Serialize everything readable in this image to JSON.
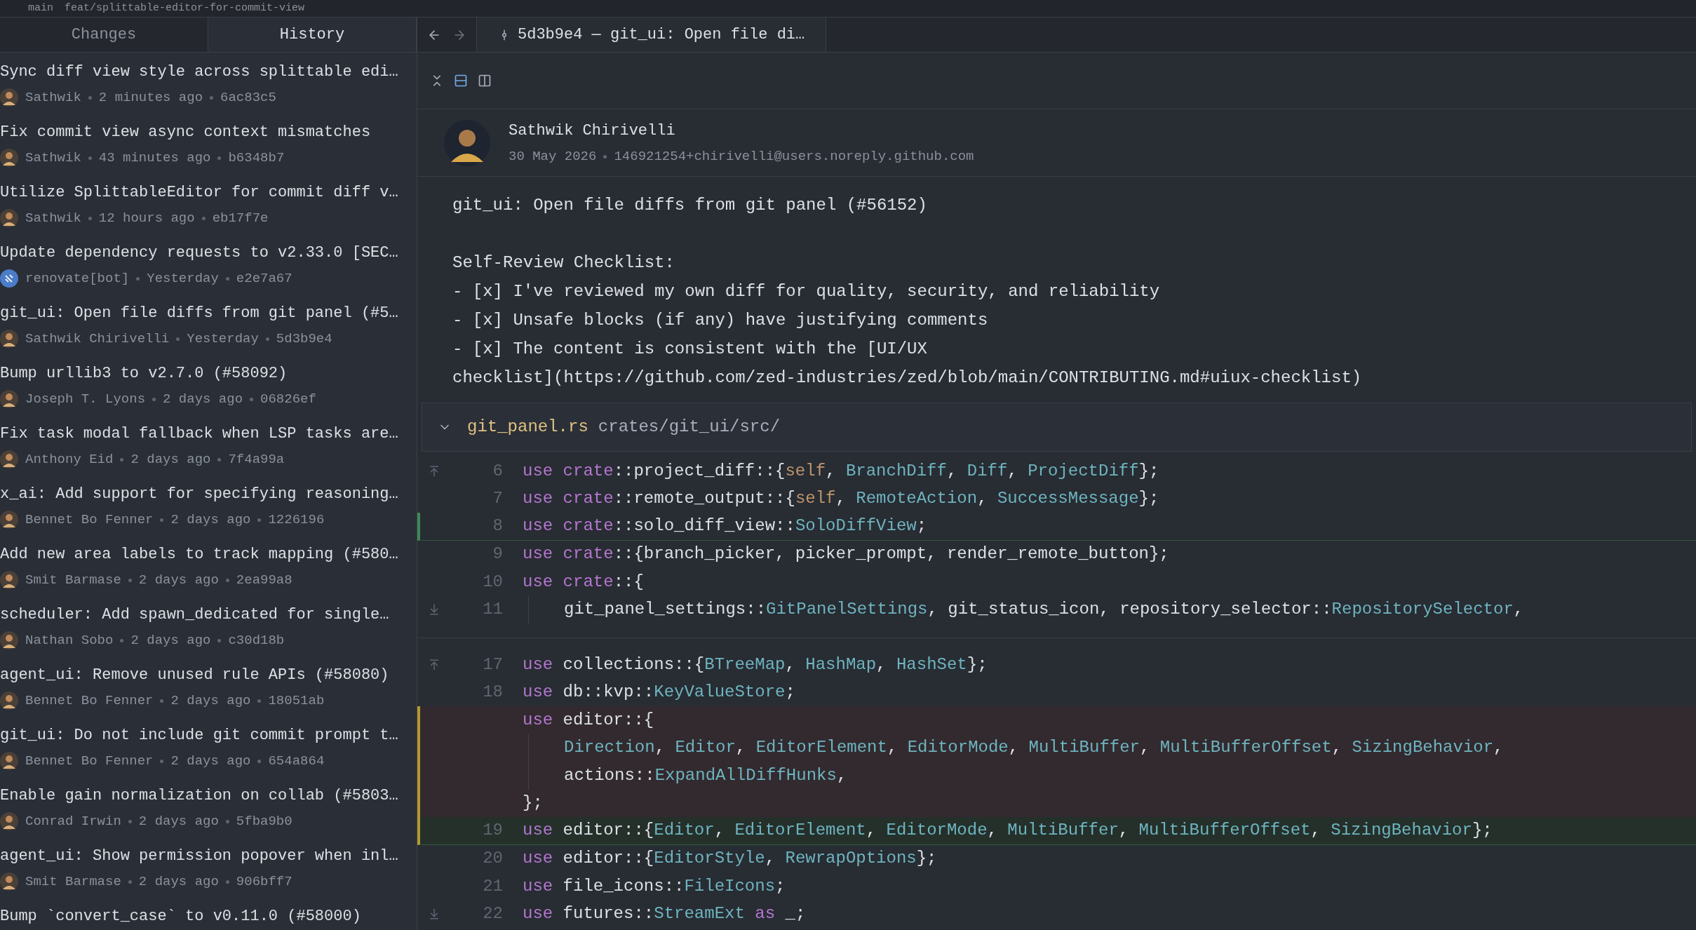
{
  "breadcrumb": [
    "main",
    "feat/splittable-editor-for-commit-view"
  ],
  "panel_tabs": [
    {
      "label": "Changes",
      "selected": false
    },
    {
      "label": "History",
      "selected": true
    }
  ],
  "commits": [
    {
      "title": "Sync diff view style across splittable edi…",
      "author": "Sathwik",
      "time": "2 minutes ago",
      "sha": "6ac83c5",
      "kind": "person"
    },
    {
      "title": "Fix commit view async context mismatches",
      "author": "Sathwik",
      "time": "43 minutes ago",
      "sha": "b6348b7",
      "kind": "person"
    },
    {
      "title": "Utilize SplittableEditor for commit diff v…",
      "author": "Sathwik",
      "time": "12 hours ago",
      "sha": "eb17f7e",
      "kind": "person"
    },
    {
      "title": "Update dependency requests to v2.33.0 [SEC…",
      "author": "renovate[bot]",
      "time": "Yesterday",
      "sha": "e2e7a67",
      "kind": "bot"
    },
    {
      "title": "git_ui: Open file diffs from git panel (#5…",
      "author": "Sathwik Chirivelli",
      "time": "Yesterday",
      "sha": "5d3b9e4",
      "kind": "person"
    },
    {
      "title": "Bump urllib3 to v2.7.0 (#58092)",
      "author": "Joseph T. Lyons",
      "time": "2 days ago",
      "sha": "06826ef",
      "kind": "person"
    },
    {
      "title": "Fix task modal fallback when LSP tasks are…",
      "author": "Anthony Eid",
      "time": "2 days ago",
      "sha": "7f4a99a",
      "kind": "person"
    },
    {
      "title": "x_ai: Add support for specifying reasoning…",
      "author": "Bennet Bo Fenner",
      "time": "2 days ago",
      "sha": "1226196",
      "kind": "person"
    },
    {
      "title": "Add new area labels to track mapping (#580…",
      "author": "Smit Barmase",
      "time": "2 days ago",
      "sha": "2ea99a8",
      "kind": "person"
    },
    {
      "title": "scheduler: Add spawn_dedicated for single…",
      "author": "Nathan Sobo",
      "time": "2 days ago",
      "sha": "c30d18b",
      "kind": "person"
    },
    {
      "title": "agent_ui: Remove unused rule APIs (#58080)",
      "author": "Bennet Bo Fenner",
      "time": "2 days ago",
      "sha": "18051ab",
      "kind": "person"
    },
    {
      "title": "git_ui: Do not include git commit prompt t…",
      "author": "Bennet Bo Fenner",
      "time": "2 days ago",
      "sha": "654a864",
      "kind": "person"
    },
    {
      "title": "Enable gain normalization on collab (#5803…",
      "author": "Conrad Irwin",
      "time": "2 days ago",
      "sha": "5fba9b0",
      "kind": "person"
    },
    {
      "title": "agent_ui: Show permission popover when inl…",
      "author": "Smit Barmase",
      "time": "2 days ago",
      "sha": "906bff7",
      "kind": "person"
    },
    {
      "title": "Bump `convert_case` to v0.11.0 (#58000)"
    }
  ],
  "editor_tab": {
    "label": "5d3b9e4 — git_ui: Open file di…",
    "selected": true
  },
  "view_modes": [
    {
      "kind": "unified",
      "selected": true
    },
    {
      "kind": "split",
      "selected": false
    }
  ],
  "commit": {
    "author": "Sathwik Chirivelli",
    "date": "30 May 2026",
    "email": "146921254+chirivelli@users.noreply.github.com",
    "message": [
      [
        "git_ui: Open file diffs from git panel (#56152)"
      ],
      [
        "Self-Review Checklist:",
        "- [x] I've reviewed my own diff for quality, security, and reliability",
        "- [x] Unsafe blocks (if any) have justifying comments",
        "- [x] The content is consistent with the [UI/UX",
        "checklist](https://github.com/zed-industries/zed/blob/main/CONTRIBUTING.md#uiux-checklist)"
      ]
    ]
  },
  "file": {
    "name": "git_panel.rs",
    "path": "crates/git_ui/src/",
    "expanded": true
  },
  "hunks": [
    [
      {
        "number": "6",
        "kind": "context",
        "indent": false,
        "expand_up": true,
        "expand_down": false,
        "tokens": [
          {
            "text": "use ",
            "kind": "keyword"
          },
          {
            "text": "crate",
            "kind": "keyword"
          },
          {
            "text": "::project_diff::{",
            "kind": "plain"
          },
          {
            "text": "self",
            "kind": "self"
          },
          {
            "text": ", ",
            "kind": "plain"
          },
          {
            "text": "BranchDiff",
            "kind": "type"
          },
          {
            "text": ", ",
            "kind": "plain"
          },
          {
            "text": "Diff",
            "kind": "type"
          },
          {
            "text": ", ",
            "kind": "plain"
          },
          {
            "text": "ProjectDiff",
            "kind": "type"
          },
          {
            "text": "};",
            "kind": "plain"
          }
        ]
      },
      {
        "number": "7",
        "kind": "context",
        "indent": false,
        "expand_up": false,
        "expand_down": false,
        "tokens": [
          {
            "text": "use ",
            "kind": "keyword"
          },
          {
            "text": "crate",
            "kind": "keyword"
          },
          {
            "text": "::remote_output::{",
            "kind": "plain"
          },
          {
            "text": "self",
            "kind": "self"
          },
          {
            "text": ", ",
            "kind": "plain"
          },
          {
            "text": "RemoteAction",
            "kind": "type"
          },
          {
            "text": ", ",
            "kind": "plain"
          },
          {
            "text": "SuccessMessage",
            "kind": "type"
          },
          {
            "text": "};",
            "kind": "plain"
          }
        ]
      },
      {
        "number": "8",
        "kind": "added",
        "indent": false,
        "expand_up": false,
        "expand_down": false,
        "tokens": [
          {
            "text": "use ",
            "kind": "keyword"
          },
          {
            "text": "crate",
            "kind": "keyword"
          },
          {
            "text": "::solo_diff_view::",
            "kind": "plain"
          },
          {
            "text": "SoloDiffView",
            "kind": "type"
          },
          {
            "text": ";",
            "kind": "plain"
          }
        ]
      },
      {
        "number": "9",
        "kind": "context",
        "indent": false,
        "expand_up": false,
        "expand_down": false,
        "tokens": [
          {
            "text": "use ",
            "kind": "keyword"
          },
          {
            "text": "crate",
            "kind": "keyword"
          },
          {
            "text": "::{branch_picker, picker_prompt, render_remote_button};",
            "kind": "plain"
          }
        ]
      },
      {
        "number": "10",
        "kind": "context",
        "indent": false,
        "expand_up": false,
        "expand_down": false,
        "tokens": [
          {
            "text": "use ",
            "kind": "keyword"
          },
          {
            "text": "crate",
            "kind": "keyword"
          },
          {
            "text": "::{",
            "kind": "plain"
          }
        ]
      },
      {
        "number": "11",
        "kind": "context",
        "indent": true,
        "expand_up": false,
        "expand_down": true,
        "tokens": [
          {
            "text": "git_panel_settings::",
            "kind": "plain"
          },
          {
            "text": "GitPanelSettings",
            "kind": "type"
          },
          {
            "text": ", git_status_icon, repository_selector::",
            "kind": "plain"
          },
          {
            "text": "RepositorySelector",
            "kind": "type"
          },
          {
            "text": ",",
            "kind": "plain"
          }
        ]
      }
    ],
    [
      {
        "number": "17",
        "kind": "context",
        "indent": false,
        "expand_up": true,
        "expand_down": false,
        "tokens": [
          {
            "text": "use ",
            "kind": "keyword"
          },
          {
            "text": "collections::{",
            "kind": "plain"
          },
          {
            "text": "BTreeMap",
            "kind": "type"
          },
          {
            "text": ", ",
            "kind": "plain"
          },
          {
            "text": "HashMap",
            "kind": "type"
          },
          {
            "text": ", ",
            "kind": "plain"
          },
          {
            "text": "HashSet",
            "kind": "type"
          },
          {
            "text": "};",
            "kind": "plain"
          }
        ]
      },
      {
        "number": "18",
        "kind": "context",
        "indent": false,
        "expand_up": false,
        "expand_down": false,
        "tokens": [
          {
            "text": "use ",
            "kind": "keyword"
          },
          {
            "text": "db::kvp::",
            "kind": "plain"
          },
          {
            "text": "KeyValueStore",
            "kind": "type"
          },
          {
            "text": ";",
            "kind": "plain"
          }
        ]
      },
      {
        "kind": "deleted",
        "indent": false,
        "expand_up": false,
        "expand_down": false,
        "tokens": [
          {
            "text": "use ",
            "kind": "keyword"
          },
          {
            "text": "editor::{",
            "kind": "plain"
          }
        ]
      },
      {
        "kind": "deleted",
        "indent": true,
        "expand_up": false,
        "expand_down": false,
        "tokens": [
          {
            "text": "Direction",
            "kind": "type"
          },
          {
            "text": ", ",
            "kind": "plain"
          },
          {
            "text": "Editor",
            "kind": "type"
          },
          {
            "text": ", ",
            "kind": "plain"
          },
          {
            "text": "EditorElement",
            "kind": "type"
          },
          {
            "text": ", ",
            "kind": "plain"
          },
          {
            "text": "EditorMode",
            "kind": "type"
          },
          {
            "text": ", ",
            "kind": "plain"
          },
          {
            "text": "MultiBuffer",
            "kind": "type"
          },
          {
            "text": ", ",
            "kind": "plain"
          },
          {
            "text": "MultiBufferOffset",
            "kind": "type"
          },
          {
            "text": ", ",
            "kind": "plain"
          },
          {
            "text": "SizingBehavior",
            "kind": "type"
          },
          {
            "text": ",",
            "kind": "plain"
          }
        ]
      },
      {
        "kind": "deleted",
        "indent": true,
        "expand_up": false,
        "expand_down": false,
        "tokens": [
          {
            "text": "actions::",
            "kind": "plain"
          },
          {
            "text": "ExpandAllDiffHunks",
            "kind": "type"
          },
          {
            "text": ",",
            "kind": "plain"
          }
        ]
      },
      {
        "kind": "deleted",
        "indent": false,
        "expand_up": false,
        "expand_down": false,
        "tokens": [
          {
            "text": "};",
            "kind": "plain"
          }
        ]
      },
      {
        "number": "19",
        "kind": "modified",
        "indent": false,
        "expand_up": false,
        "expand_down": false,
        "tokens": [
          {
            "text": "use ",
            "kind": "keyword"
          },
          {
            "text": "editor::{",
            "kind": "plain"
          },
          {
            "text": "Editor",
            "kind": "type"
          },
          {
            "text": ", ",
            "kind": "plain"
          },
          {
            "text": "EditorElement",
            "kind": "type"
          },
          {
            "text": ", ",
            "kind": "plain"
          },
          {
            "text": "EditorMode",
            "kind": "type"
          },
          {
            "text": ", ",
            "kind": "plain"
          },
          {
            "text": "MultiBuffer",
            "kind": "type"
          },
          {
            "text": ", ",
            "kind": "plain"
          },
          {
            "text": "MultiBufferOffset",
            "kind": "type"
          },
          {
            "text": ", ",
            "kind": "plain"
          },
          {
            "text": "SizingBehavior",
            "kind": "type"
          },
          {
            "text": "};",
            "kind": "plain"
          }
        ]
      },
      {
        "number": "20",
        "kind": "context",
        "indent": false,
        "expand_up": false,
        "expand_down": false,
        "tokens": [
          {
            "text": "use ",
            "kind": "keyword"
          },
          {
            "text": "editor::{",
            "kind": "plain"
          },
          {
            "text": "EditorStyle",
            "kind": "type"
          },
          {
            "text": ", ",
            "kind": "plain"
          },
          {
            "text": "RewrapOptions",
            "kind": "type"
          },
          {
            "text": "};",
            "kind": "plain"
          }
        ]
      },
      {
        "number": "21",
        "kind": "context",
        "indent": false,
        "expand_up": false,
        "expand_down": false,
        "tokens": [
          {
            "text": "use ",
            "kind": "keyword"
          },
          {
            "text": "file_icons::",
            "kind": "plain"
          },
          {
            "text": "FileIcons",
            "kind": "type"
          },
          {
            "text": ";",
            "kind": "plain"
          }
        ]
      },
      {
        "number": "22",
        "kind": "context",
        "indent": false,
        "expand_up": false,
        "expand_down": true,
        "tokens": [
          {
            "text": "use ",
            "kind": "keyword"
          },
          {
            "text": "futures::",
            "kind": "plain"
          },
          {
            "text": "StreamExt",
            "kind": "type"
          },
          {
            "text": " as",
            "kind": "keyword"
          },
          {
            "text": " _;",
            "kind": "plain"
          }
        ]
      }
    ]
  ]
}
